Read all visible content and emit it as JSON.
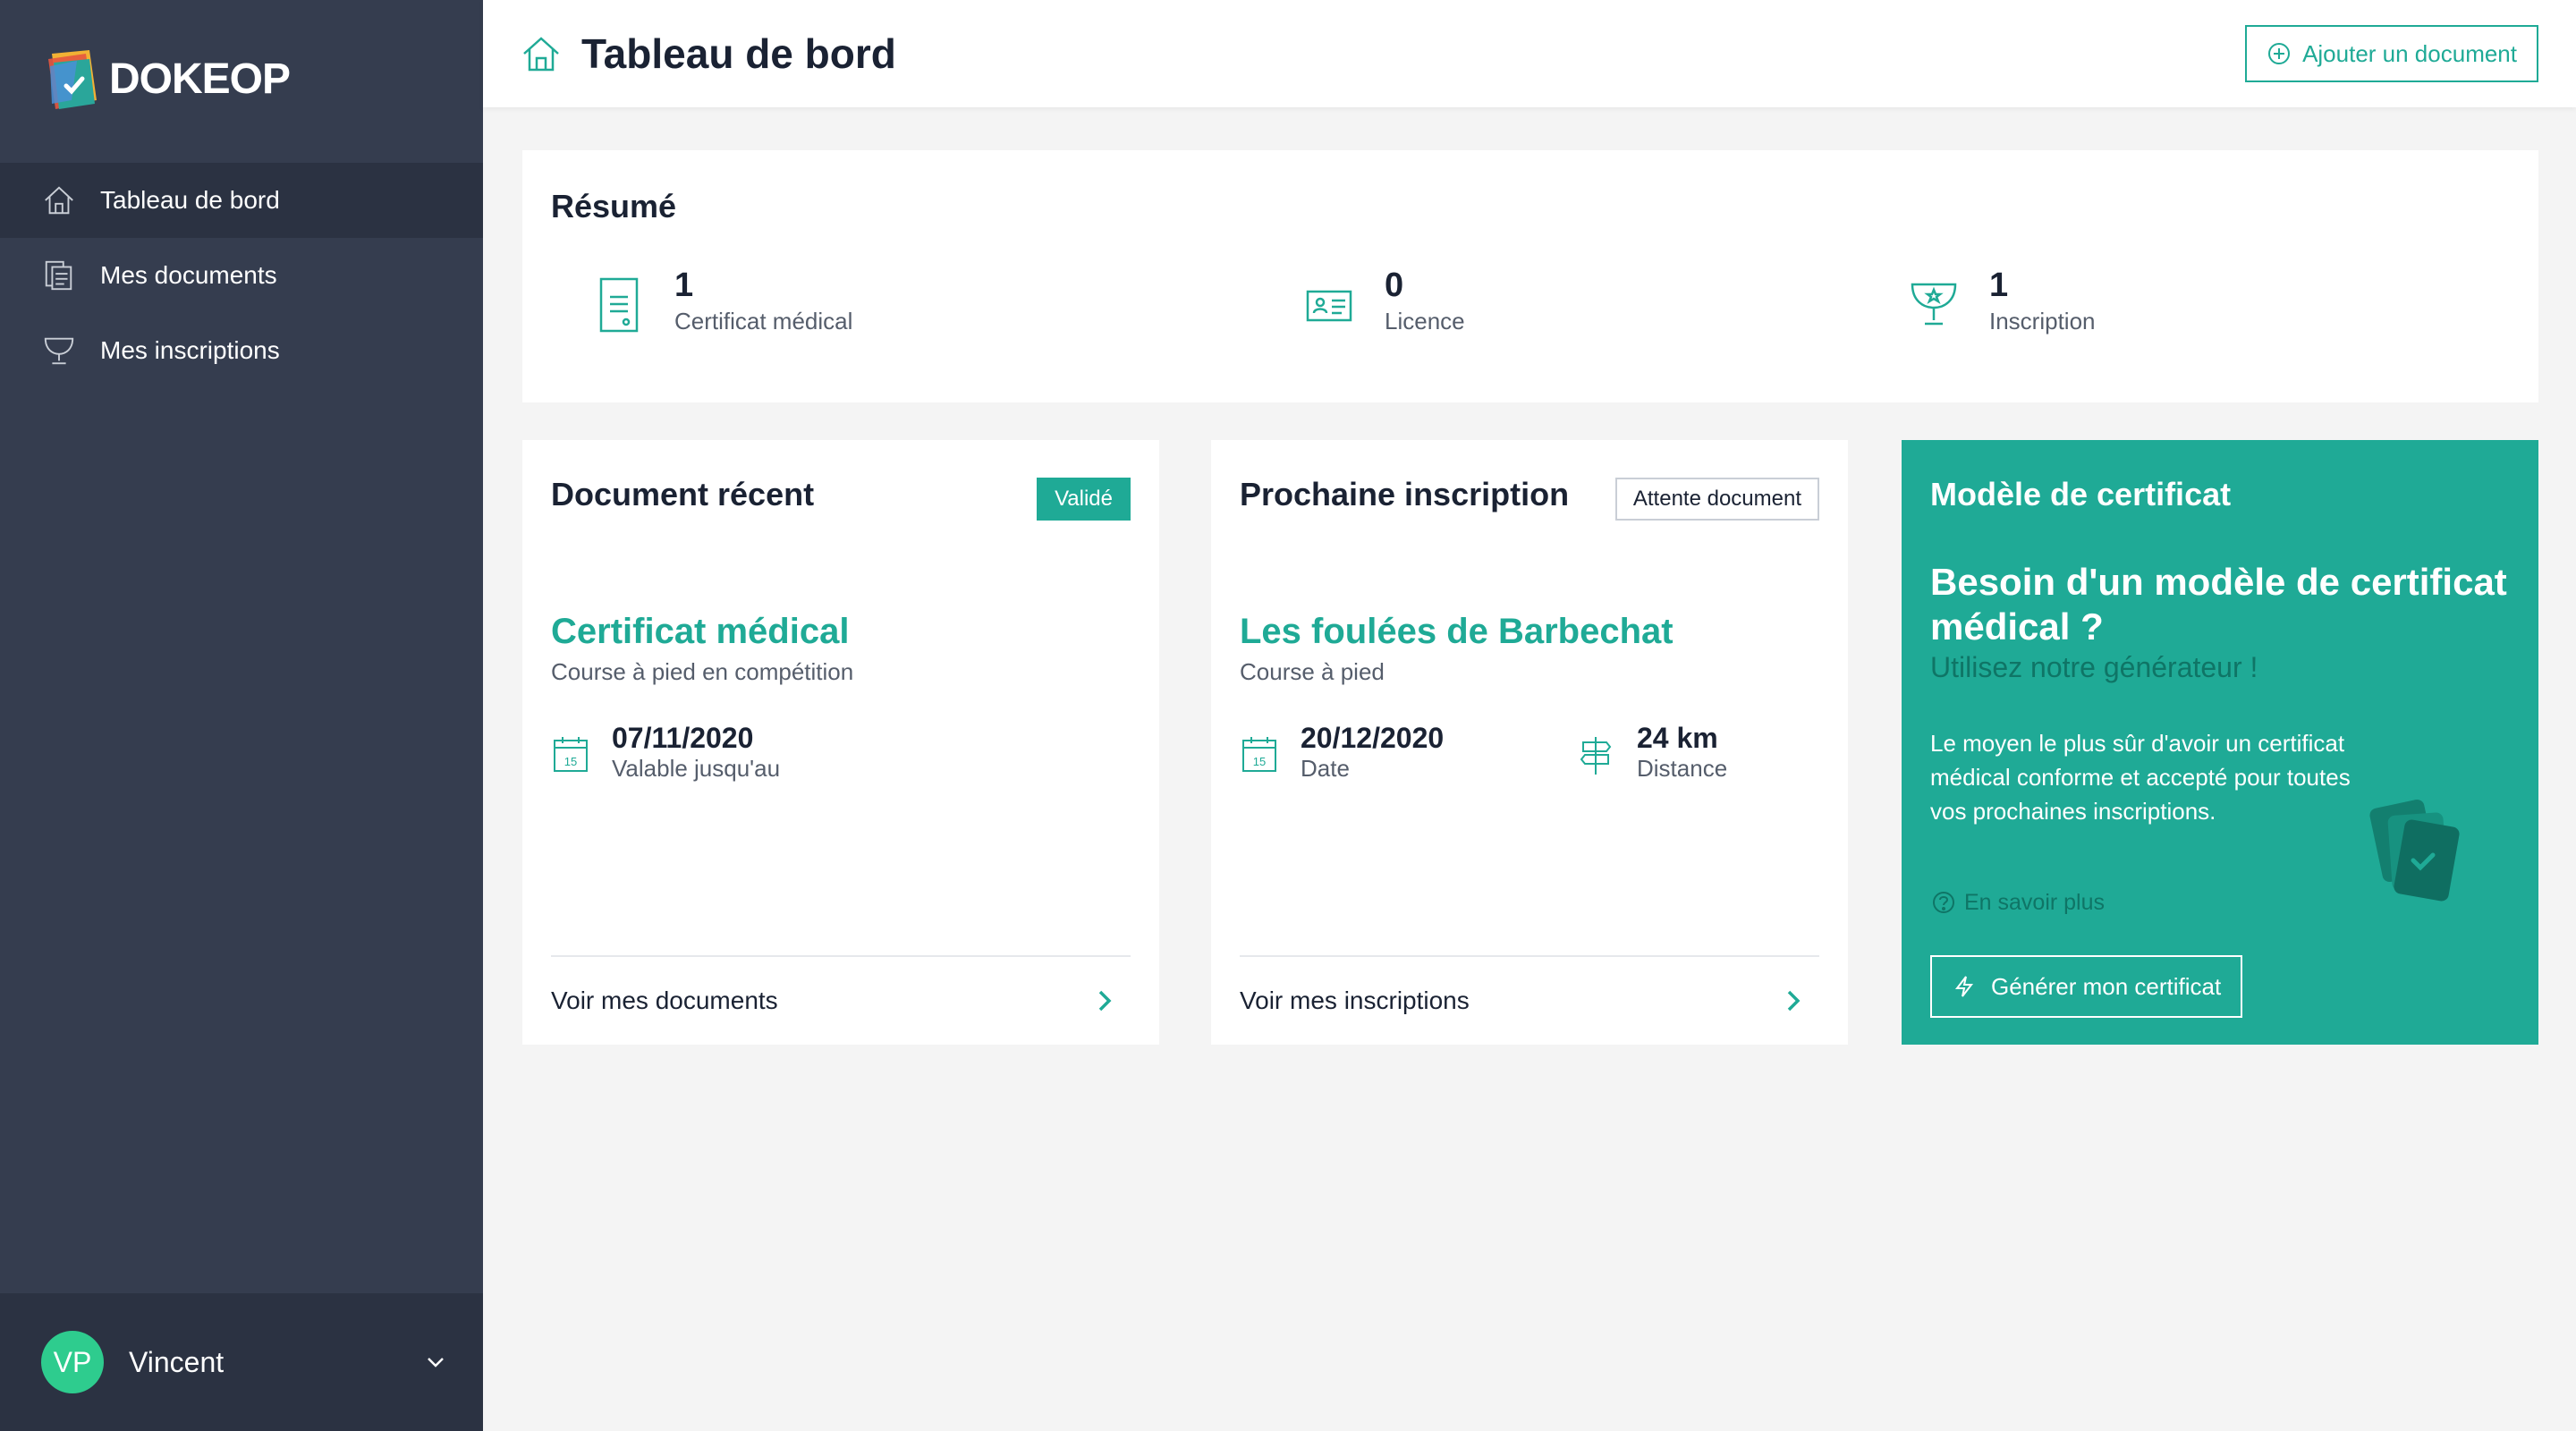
{
  "brand": {
    "name": "DOKEOP"
  },
  "sidebar": {
    "items": [
      {
        "label": "Tableau de bord",
        "icon": "home-icon",
        "active": true
      },
      {
        "label": "Mes documents",
        "icon": "documents-icon",
        "active": false
      },
      {
        "label": "Mes inscriptions",
        "icon": "trophy-icon",
        "active": false
      }
    ],
    "user": {
      "initials": "VP",
      "name": "Vincent"
    }
  },
  "header": {
    "title": "Tableau de bord",
    "add_button": "Ajouter un document"
  },
  "resume": {
    "title": "Résumé",
    "stats": [
      {
        "value": "1",
        "label": "Certificat médical",
        "icon": "certificate-icon"
      },
      {
        "value": "0",
        "label": "Licence",
        "icon": "license-card-icon"
      },
      {
        "value": "1",
        "label": "Inscription",
        "icon": "trophy-icon"
      }
    ]
  },
  "recent_document": {
    "title": "Document récent",
    "badge": "Validé",
    "item_title": "Certificat médical",
    "item_sub": "Course à pied en compétition",
    "date_value": "07/11/2020",
    "date_label": "Valable jusqu'au",
    "footer": "Voir mes documents"
  },
  "next_registration": {
    "title": "Prochaine inscription",
    "badge": "Attente document",
    "item_title": "Les foulées de Barbechat",
    "item_sub": "Course à pied",
    "date_value": "20/12/2020",
    "date_label": "Date",
    "distance_value": "24 km",
    "distance_label": "Distance",
    "footer": "Voir mes inscriptions"
  },
  "certificate_model": {
    "title": "Modèle de certificat",
    "headline": "Besoin d'un modèle de certificat médical ?",
    "subline": "Utilisez notre générateur !",
    "description": "Le moyen le plus sûr d'avoir un certificat médical conforme et accepté pour toutes vos prochaines inscriptions.",
    "more_link": "En savoir plus",
    "generate_button": "Générer mon certificat"
  },
  "calendar_icon_day": "15",
  "colors": {
    "accent": "#1faa96",
    "sidebar": "#353d4f",
    "sidebar_dark": "#2b3242",
    "avatar": "#2ecc8e"
  }
}
